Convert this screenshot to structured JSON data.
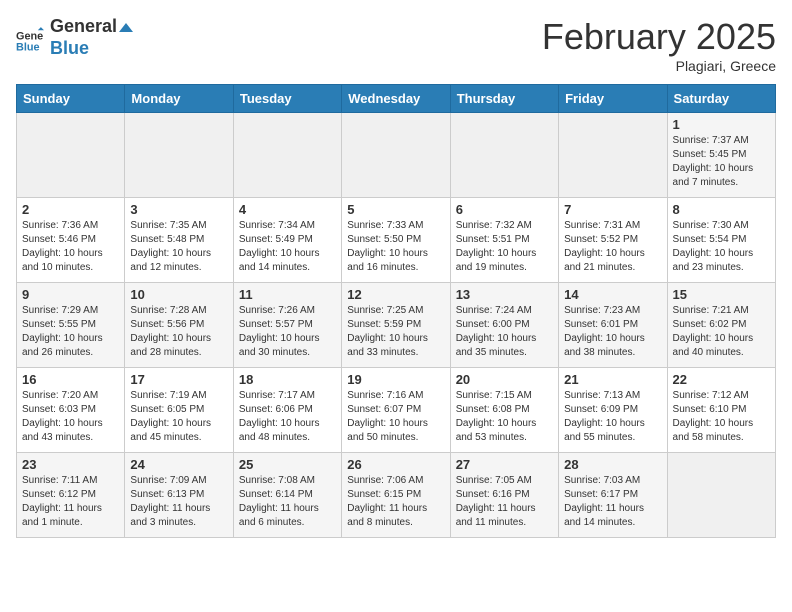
{
  "header": {
    "logo_general": "General",
    "logo_blue": "Blue",
    "month_title": "February 2025",
    "location": "Plagiari, Greece"
  },
  "weekdays": [
    "Sunday",
    "Monday",
    "Tuesday",
    "Wednesday",
    "Thursday",
    "Friday",
    "Saturday"
  ],
  "weeks": [
    [
      {
        "day": "",
        "info": ""
      },
      {
        "day": "",
        "info": ""
      },
      {
        "day": "",
        "info": ""
      },
      {
        "day": "",
        "info": ""
      },
      {
        "day": "",
        "info": ""
      },
      {
        "day": "",
        "info": ""
      },
      {
        "day": "1",
        "info": "Sunrise: 7:37 AM\nSunset: 5:45 PM\nDaylight: 10 hours and 7 minutes."
      }
    ],
    [
      {
        "day": "2",
        "info": "Sunrise: 7:36 AM\nSunset: 5:46 PM\nDaylight: 10 hours and 10 minutes."
      },
      {
        "day": "3",
        "info": "Sunrise: 7:35 AM\nSunset: 5:48 PM\nDaylight: 10 hours and 12 minutes."
      },
      {
        "day": "4",
        "info": "Sunrise: 7:34 AM\nSunset: 5:49 PM\nDaylight: 10 hours and 14 minutes."
      },
      {
        "day": "5",
        "info": "Sunrise: 7:33 AM\nSunset: 5:50 PM\nDaylight: 10 hours and 16 minutes."
      },
      {
        "day": "6",
        "info": "Sunrise: 7:32 AM\nSunset: 5:51 PM\nDaylight: 10 hours and 19 minutes."
      },
      {
        "day": "7",
        "info": "Sunrise: 7:31 AM\nSunset: 5:52 PM\nDaylight: 10 hours and 21 minutes."
      },
      {
        "day": "8",
        "info": "Sunrise: 7:30 AM\nSunset: 5:54 PM\nDaylight: 10 hours and 23 minutes."
      }
    ],
    [
      {
        "day": "9",
        "info": "Sunrise: 7:29 AM\nSunset: 5:55 PM\nDaylight: 10 hours and 26 minutes."
      },
      {
        "day": "10",
        "info": "Sunrise: 7:28 AM\nSunset: 5:56 PM\nDaylight: 10 hours and 28 minutes."
      },
      {
        "day": "11",
        "info": "Sunrise: 7:26 AM\nSunset: 5:57 PM\nDaylight: 10 hours and 30 minutes."
      },
      {
        "day": "12",
        "info": "Sunrise: 7:25 AM\nSunset: 5:59 PM\nDaylight: 10 hours and 33 minutes."
      },
      {
        "day": "13",
        "info": "Sunrise: 7:24 AM\nSunset: 6:00 PM\nDaylight: 10 hours and 35 minutes."
      },
      {
        "day": "14",
        "info": "Sunrise: 7:23 AM\nSunset: 6:01 PM\nDaylight: 10 hours and 38 minutes."
      },
      {
        "day": "15",
        "info": "Sunrise: 7:21 AM\nSunset: 6:02 PM\nDaylight: 10 hours and 40 minutes."
      }
    ],
    [
      {
        "day": "16",
        "info": "Sunrise: 7:20 AM\nSunset: 6:03 PM\nDaylight: 10 hours and 43 minutes."
      },
      {
        "day": "17",
        "info": "Sunrise: 7:19 AM\nSunset: 6:05 PM\nDaylight: 10 hours and 45 minutes."
      },
      {
        "day": "18",
        "info": "Sunrise: 7:17 AM\nSunset: 6:06 PM\nDaylight: 10 hours and 48 minutes."
      },
      {
        "day": "19",
        "info": "Sunrise: 7:16 AM\nSunset: 6:07 PM\nDaylight: 10 hours and 50 minutes."
      },
      {
        "day": "20",
        "info": "Sunrise: 7:15 AM\nSunset: 6:08 PM\nDaylight: 10 hours and 53 minutes."
      },
      {
        "day": "21",
        "info": "Sunrise: 7:13 AM\nSunset: 6:09 PM\nDaylight: 10 hours and 55 minutes."
      },
      {
        "day": "22",
        "info": "Sunrise: 7:12 AM\nSunset: 6:10 PM\nDaylight: 10 hours and 58 minutes."
      }
    ],
    [
      {
        "day": "23",
        "info": "Sunrise: 7:11 AM\nSunset: 6:12 PM\nDaylight: 11 hours and 1 minute."
      },
      {
        "day": "24",
        "info": "Sunrise: 7:09 AM\nSunset: 6:13 PM\nDaylight: 11 hours and 3 minutes."
      },
      {
        "day": "25",
        "info": "Sunrise: 7:08 AM\nSunset: 6:14 PM\nDaylight: 11 hours and 6 minutes."
      },
      {
        "day": "26",
        "info": "Sunrise: 7:06 AM\nSunset: 6:15 PM\nDaylight: 11 hours and 8 minutes."
      },
      {
        "day": "27",
        "info": "Sunrise: 7:05 AM\nSunset: 6:16 PM\nDaylight: 11 hours and 11 minutes."
      },
      {
        "day": "28",
        "info": "Sunrise: 7:03 AM\nSunset: 6:17 PM\nDaylight: 11 hours and 14 minutes."
      },
      {
        "day": "",
        "info": ""
      }
    ]
  ]
}
